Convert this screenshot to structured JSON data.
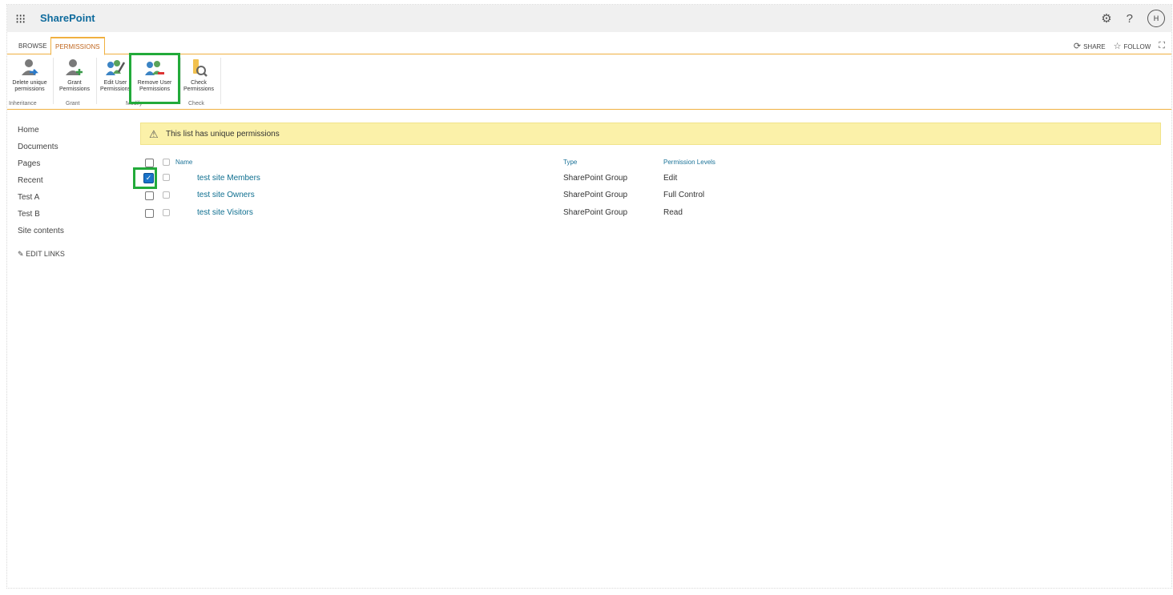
{
  "suitebar": {
    "app_name": "SharePoint",
    "user_initial": "H"
  },
  "tabs": [
    {
      "label": "BROWSE"
    },
    {
      "label": "PERMISSIONS"
    }
  ],
  "page_actions": {
    "share": "SHARE",
    "follow": "FOLLOW"
  },
  "ribbon": {
    "buttons": [
      {
        "label1": "Delete unique",
        "label2": "permissions"
      },
      {
        "label1": "Grant",
        "label2": "Permissions"
      },
      {
        "label1": "Edit User",
        "label2": "Permissions"
      },
      {
        "label1": "Remove User",
        "label2": "Permissions"
      },
      {
        "label1": "Check",
        "label2": "Permissions"
      }
    ],
    "groups": [
      {
        "label": "Inheritance"
      },
      {
        "label": "Grant"
      },
      {
        "label": "Modify"
      },
      {
        "label": "Check"
      }
    ]
  },
  "leftnav": {
    "items": [
      "Home",
      "Documents",
      "Pages",
      "Recent",
      "Test A",
      "Test B",
      "Site contents"
    ],
    "edit_links": "EDIT LINKS"
  },
  "banner": {
    "text": "This list has unique permissions"
  },
  "table": {
    "headers": {
      "name": "Name",
      "type": "Type",
      "level": "Permission Levels"
    },
    "rows": [
      {
        "name": "test site Members",
        "type": "SharePoint Group",
        "level": "Edit",
        "checked": true
      },
      {
        "name": "test site Owners",
        "type": "SharePoint Group",
        "level": "Full Control",
        "checked": false
      },
      {
        "name": "test site Visitors",
        "type": "SharePoint Group",
        "level": "Read",
        "checked": false
      }
    ]
  },
  "colors": {
    "accent": "#f0b040",
    "link": "#0d6e8f",
    "highlight": "#22aa3a",
    "banner": "#fbf1a9"
  }
}
